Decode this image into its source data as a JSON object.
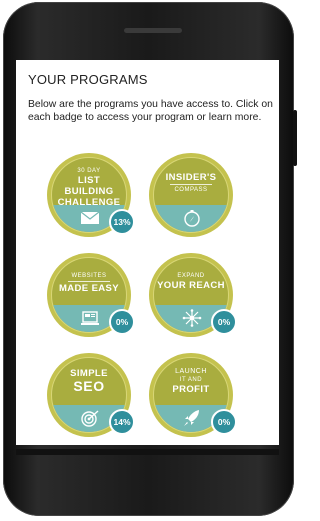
{
  "page": {
    "title": "YOUR PROGRAMS",
    "intro": "Below are the programs you have access to. Click on each badge to access your program or learn more."
  },
  "badges": [
    {
      "line1": "30 DAY",
      "line2": "LIST BUILDING",
      "line3": "CHALLENGE",
      "percent": "13%",
      "icon": "envelope-icon"
    },
    {
      "line1": "INSIDER'S",
      "line2": "COMPASS",
      "percent": "",
      "icon": "compass-icon"
    },
    {
      "line1": "WEBSITES",
      "line2": "MADE EASY",
      "percent": "0%",
      "icon": "laptop-icon"
    },
    {
      "line1": "EXPAND",
      "line2": "YOUR REACH",
      "percent": "0%",
      "icon": "network-icon"
    },
    {
      "line1": "SIMPLE",
      "line2": "SEO",
      "percent": "14%",
      "icon": "target-icon"
    },
    {
      "line1": "LAUNCH",
      "line2": "IT AND",
      "line3": "PROFIT",
      "percent": "0%",
      "icon": "rocket-icon"
    }
  ]
}
